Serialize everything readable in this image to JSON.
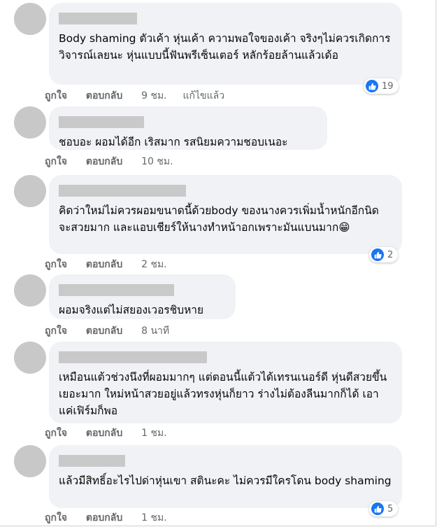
{
  "comments": [
    {
      "text": "Body shaming ตัวเค้า หุ่นเค้า ความพอใจของเค้า จริงๆไม่ควรเกิดการวิจารณ์เลยนะ หุ่นแบบนี้ฟันพรีเซ็นเตอร์ หลักร้อยล้านแล้วเด้อ",
      "like": "ถูกใจ",
      "reply": "ตอบกลับ",
      "time": "9 ชม.",
      "edited": "แก้ไขแล้ว",
      "reactions": "19"
    },
    {
      "text": "ชอบอะ ผอมได้อีก เริสมาก รสนิยมความชอบเนอะ",
      "like": "ถูกใจ",
      "reply": "ตอบกลับ",
      "time": "10 ชม."
    },
    {
      "text": "คิดว่าใหม่ไม่ควรผอมขนาดนี้ด้วยbody ของนางควรเพิ่มน้ำหนักอีกนิด จะสวยมาก และแอบเชียร์ให้นางทำหน้าอกเพราะมันแบนมาก😁",
      "like": "ถูกใจ",
      "reply": "ตอบกลับ",
      "time": "2 ชม.",
      "reactions": "2"
    },
    {
      "text": "ผอมจริงแต่ไม่สยองเวอรชิบหาย",
      "like": "ถูกใจ",
      "reply": "ตอบกลับ",
      "time": "8 นาที"
    },
    {
      "text": "เหมือนแต้วช่วงนึงที่ผอมมากๆ แต่ตอนนี้แต้วได้เทรนเนอร์ดี หุ่นดีสวยขึ้นเยอะมาก ใหม่หน้าสวยอยู่แล้วทรงหุ่นก็ยาว ร่างไม่ต้องลีนมากก็ได้ เอาแค่เฟิร์มก็พอ",
      "like": "ถูกใจ",
      "reply": "ตอบกลับ",
      "time": "1 ชม."
    },
    {
      "text": "แล้วมีสิทธิ์อะไรไปด่าหุ่นเขา สตินะคะ ไม่ควรมีใครโดน body shaming",
      "like": "ถูกใจ",
      "reply": "ตอบกลับ",
      "time": "1 ชม.",
      "reactions": "5"
    }
  ],
  "colors": {
    "bubble": "#f0f2f5",
    "meta": "#65676b",
    "like_blue": "#1877f2"
  },
  "icons": {
    "reaction": "like-thumbs-up-icon"
  }
}
